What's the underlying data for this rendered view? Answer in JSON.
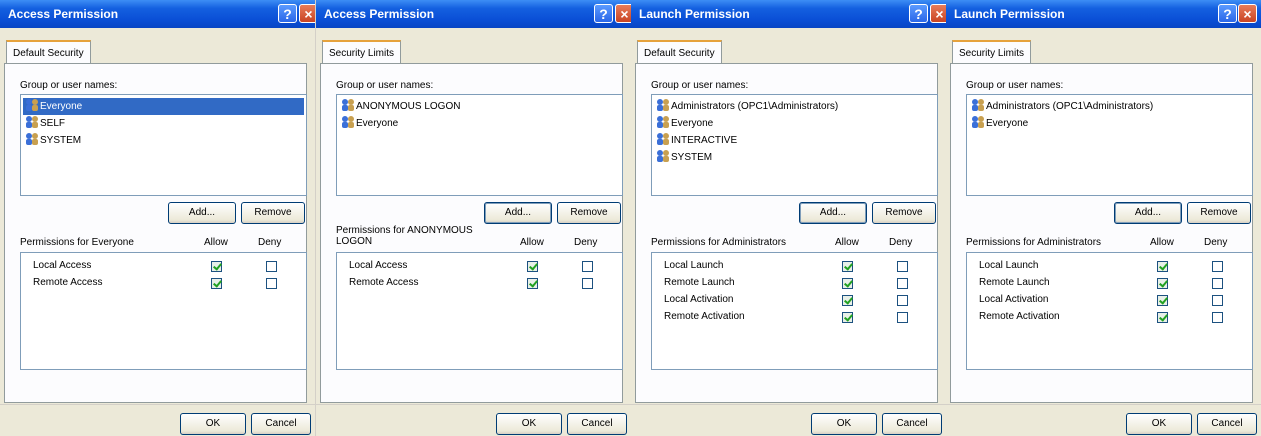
{
  "dialogs": [
    {
      "title": "Access Permission",
      "tab": "Default Security",
      "group_label": "Group or user names:",
      "users": [
        {
          "name": "Everyone",
          "selected": true
        },
        {
          "name": "SELF",
          "selected": false
        },
        {
          "name": "SYSTEM",
          "selected": false
        }
      ],
      "add_label": "Add...",
      "remove_label": "Remove",
      "permissions_label": "Permissions for Everyone",
      "allow_label": "Allow",
      "deny_label": "Deny",
      "permissions": [
        {
          "name": "Local Access",
          "allow": true,
          "deny": false
        },
        {
          "name": "Remote Access",
          "allow": true,
          "deny": false
        }
      ],
      "ok_label": "OK",
      "cancel_label": "Cancel"
    },
    {
      "title": "Access Permission",
      "tab": "Security Limits",
      "group_label": "Group or user names:",
      "users": [
        {
          "name": "ANONYMOUS LOGON",
          "selected": false
        },
        {
          "name": "Everyone",
          "selected": false
        }
      ],
      "add_label": "Add...",
      "remove_label": "Remove",
      "permissions_label": "Permissions for ANONYMOUS LOGON",
      "allow_label": "Allow",
      "deny_label": "Deny",
      "permissions": [
        {
          "name": "Local Access",
          "allow": true,
          "deny": false
        },
        {
          "name": "Remote Access",
          "allow": true,
          "deny": false
        }
      ],
      "ok_label": "OK",
      "cancel_label": "Cancel"
    },
    {
      "title": "Launch Permission",
      "tab": "Default Security",
      "group_label": "Group or user names:",
      "users": [
        {
          "name": "Administrators (OPC1\\Administrators)",
          "selected": false
        },
        {
          "name": "Everyone",
          "selected": false
        },
        {
          "name": "INTERACTIVE",
          "selected": false
        },
        {
          "name": "SYSTEM",
          "selected": false
        }
      ],
      "add_label": "Add...",
      "remove_label": "Remove",
      "permissions_label": "Permissions for Administrators",
      "allow_label": "Allow",
      "deny_label": "Deny",
      "permissions": [
        {
          "name": "Local Launch",
          "allow": true,
          "deny": false
        },
        {
          "name": "Remote Launch",
          "allow": true,
          "deny": false
        },
        {
          "name": "Local Activation",
          "allow": true,
          "deny": false
        },
        {
          "name": "Remote Activation",
          "allow": true,
          "deny": false
        }
      ],
      "ok_label": "OK",
      "cancel_label": "Cancel"
    },
    {
      "title": "Launch Permission",
      "tab": "Security Limits",
      "group_label": "Group or user names:",
      "users": [
        {
          "name": "Administrators (OPC1\\Administrators)",
          "selected": false
        },
        {
          "name": "Everyone",
          "selected": false
        }
      ],
      "add_label": "Add...",
      "remove_label": "Remove",
      "permissions_label": "Permissions for Administrators",
      "allow_label": "Allow",
      "deny_label": "Deny",
      "permissions": [
        {
          "name": "Local Launch",
          "allow": true,
          "deny": false
        },
        {
          "name": "Remote Launch",
          "allow": true,
          "deny": false
        },
        {
          "name": "Local Activation",
          "allow": true,
          "deny": false
        },
        {
          "name": "Remote Activation",
          "allow": true,
          "deny": false
        }
      ],
      "ok_label": "OK",
      "cancel_label": "Cancel"
    }
  ],
  "icons": {
    "help": "help-icon",
    "close": "close-icon",
    "user_group": "user-group-icon"
  },
  "colors": {
    "titlebar": "#0a4fd6",
    "selection": "#316ac5",
    "check": "#21a121",
    "close_button": "#c94423"
  }
}
